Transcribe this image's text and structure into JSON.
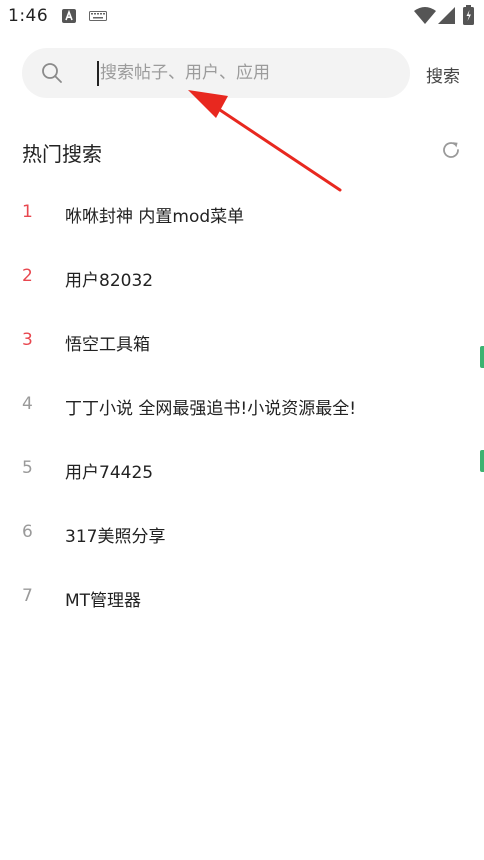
{
  "status_bar": {
    "time": "1:46",
    "icons": [
      "a-badge-icon",
      "keyboard-icon",
      "wifi-icon",
      "signal-icon",
      "battery-icon"
    ]
  },
  "search": {
    "placeholder": "搜索帖子、用户、应用",
    "value": "",
    "button_label": "搜索"
  },
  "hot_search": {
    "title": "热门搜索",
    "accent_color": "#e8474f",
    "muted_color": "#9a9a9a",
    "items": [
      {
        "rank": "1",
        "text": "咻咻封神 内置mod菜单"
      },
      {
        "rank": "2",
        "text": "用户82032"
      },
      {
        "rank": "3",
        "text": "悟空工具箱"
      },
      {
        "rank": "4",
        "text": "丁丁小说 全网最强追书!小说资源最全!"
      },
      {
        "rank": "5",
        "text": "用户74425"
      },
      {
        "rank": "6",
        "text": "317美照分享"
      },
      {
        "rank": "7",
        "text": "MT管理器"
      }
    ]
  },
  "annotation": {
    "arrow_color": "#e8281f"
  }
}
